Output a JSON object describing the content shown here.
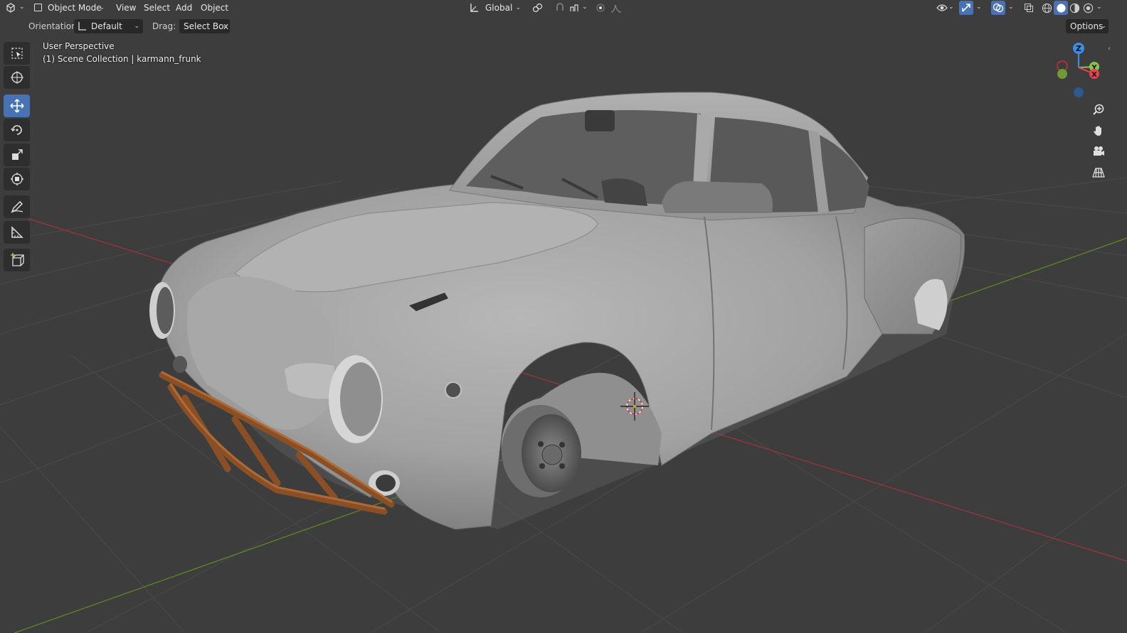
{
  "header": {
    "editor_type_icon": "editor-type-3d-viewport-icon",
    "mode": "Object Mode",
    "menus": [
      "View",
      "Select",
      "Add",
      "Object"
    ],
    "transform_orientation": "Global",
    "shading_icons": [
      "wireframe-icon",
      "solid-icon",
      "material-preview-icon",
      "rendered-icon"
    ]
  },
  "tool_header": {
    "orientation_label": "Orientation:",
    "orientation_value": "Default",
    "drag_label": "Drag:",
    "drag_value": "Select Box",
    "options_label": "Options"
  },
  "viewport": {
    "perspective_label": "User Perspective",
    "collection_label": "(1) Scene Collection | karmann_frunk"
  },
  "toolbar": {
    "tools": [
      "select-box-tool",
      "cursor-tool",
      "move-tool",
      "rotate-tool",
      "scale-tool",
      "transform-tool",
      "annotate-tool",
      "measure-tool",
      "add-cube-tool"
    ],
    "active_tool": "move-tool"
  },
  "gizmo": {
    "axes": [
      "Z",
      "Y",
      "X"
    ],
    "colors": {
      "x": "#e84055",
      "y": "#8bc34a",
      "z": "#3b8ee8"
    }
  },
  "colors": {
    "background": "#3d3d3d",
    "header": "#303030",
    "accent": "#4772b3",
    "x_axis": "#b8343f",
    "y_axis": "#6a9b2a"
  }
}
